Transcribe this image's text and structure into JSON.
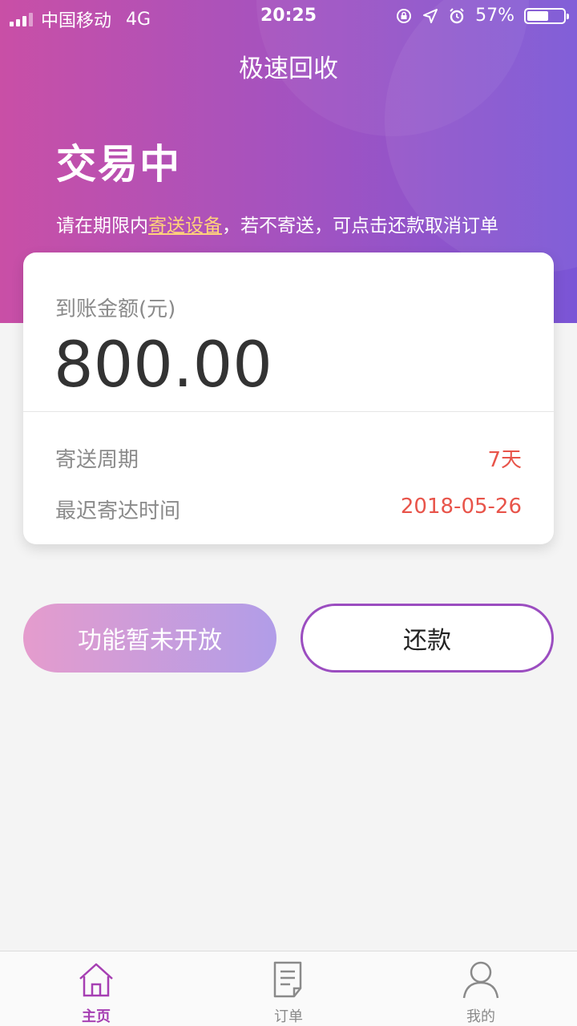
{
  "status_bar": {
    "carrier": "中国移动",
    "network": "4G",
    "time": "20:25",
    "battery": "57%"
  },
  "header": {
    "title": "极速回收",
    "state": "交易中",
    "desc_prefix": "请在期限内",
    "desc_link": "寄送设备",
    "desc_suffix": "，若不寄送，可点击还款取消订单"
  },
  "card": {
    "amount_label": "到账金额(元)",
    "amount": "800.00",
    "rows": [
      {
        "label": "寄送周期",
        "value": "7天"
      },
      {
        "label": "最迟寄达时间",
        "value": "2018-05-26"
      }
    ]
  },
  "actions": {
    "disabled_label": "功能暂未开放",
    "repay_label": "还款"
  },
  "tabbar": {
    "items": [
      {
        "label": "主页",
        "icon": "home-icon",
        "active": true
      },
      {
        "label": "订单",
        "icon": "order-icon",
        "active": false
      },
      {
        "label": "我的",
        "icon": "user-icon",
        "active": false
      }
    ]
  },
  "colors": {
    "accent": "#a63fb3",
    "highlight": "#e8544a",
    "link": "#ffd27a"
  }
}
